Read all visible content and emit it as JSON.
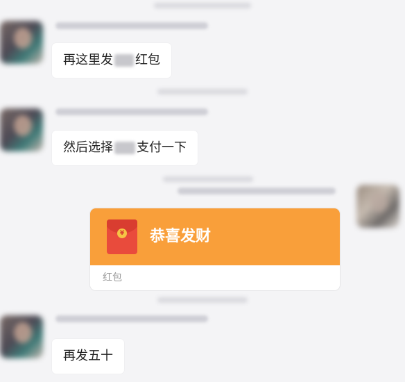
{
  "messages": [
    {
      "text_before": "再这里发",
      "text_after": "红包"
    },
    {
      "text_before": "然后选择",
      "text_after": "支付一下"
    },
    {
      "text_before": "再发五十",
      "text_after": ""
    }
  ],
  "red_packet": {
    "title": "恭喜发财",
    "label": "红包",
    "currency_symbol": "¥",
    "color": "#f99f3a"
  }
}
